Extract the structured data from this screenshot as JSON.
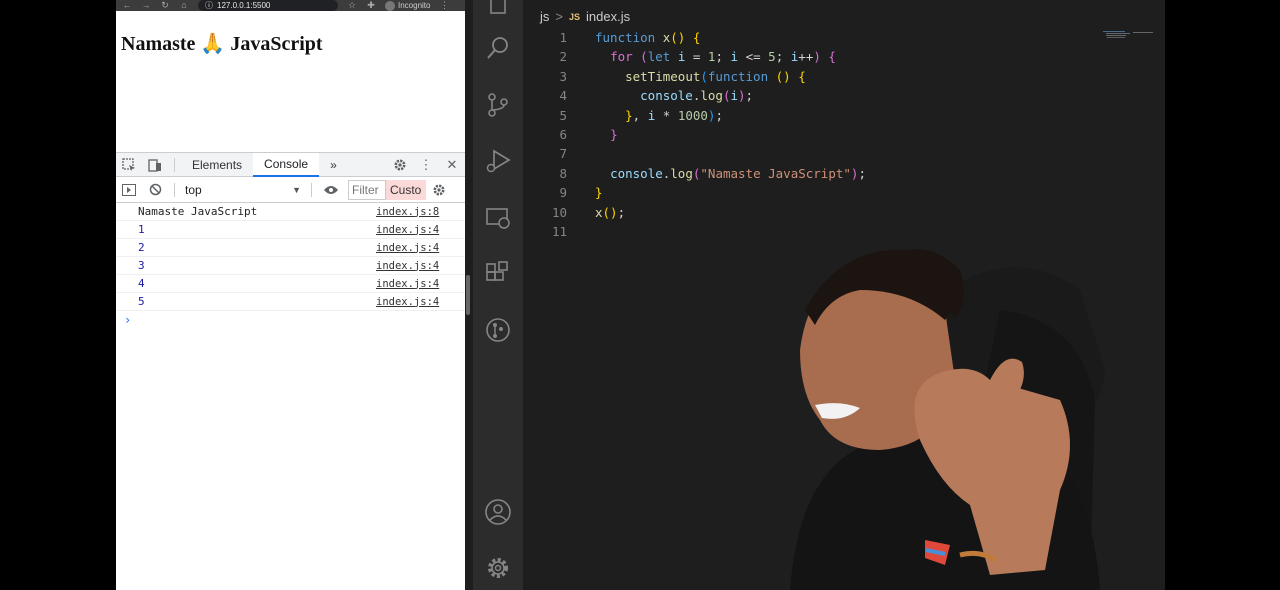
{
  "browser": {
    "url": "127.0.0.1:5500",
    "incognito_label": "Incognito",
    "page_heading": "Namaste 🙏 JavaScript"
  },
  "devtools": {
    "tabs": [
      "Elements",
      "Console"
    ],
    "active_tab": "Console",
    "more_tabs": "»",
    "context": "top",
    "filter_placeholder": "Filter",
    "custom_levels": "Custo",
    "console": [
      {
        "message": "Namaste JavaScript",
        "source": "index.js:8"
      },
      {
        "message": "1",
        "source": "index.js:4"
      },
      {
        "message": "2",
        "source": "index.js:4"
      },
      {
        "message": "3",
        "source": "index.js:4"
      },
      {
        "message": "4",
        "source": "index.js:4"
      },
      {
        "message": "5",
        "source": "index.js:4"
      }
    ],
    "prompt": "›"
  },
  "editor": {
    "breadcrumb_folder": "js",
    "breadcrumb_sep": ">",
    "breadcrumb_badge": "JS",
    "breadcrumb_file": "index.js",
    "line_numbers": [
      "1",
      "2",
      "3",
      "4",
      "5",
      "6",
      "7",
      "8",
      "9",
      "10",
      "11"
    ],
    "code": [
      "function x() {",
      "  for (let i = 1; i <= 5; i++) {",
      "    setTimeout(function () {",
      "      console.log(i);",
      "    }, i * 1000);",
      "  }",
      "",
      "  console.log(\"Namaste JavaScript\");",
      "}",
      "x();",
      ""
    ]
  },
  "activity_bar": {
    "icons": [
      "search-icon",
      "source-control-icon",
      "run-debug-icon",
      "remote-explorer-icon",
      "extensions-icon",
      "git-graph-icon",
      "account-icon",
      "settings-gear-icon"
    ]
  },
  "colors": {
    "editor_bg": "#1e1e1e",
    "activity_bg": "#2c2c2c",
    "keyword": "#569cd6",
    "function": "#dcdcaa",
    "string": "#ce9178",
    "number": "#b5cea8"
  }
}
